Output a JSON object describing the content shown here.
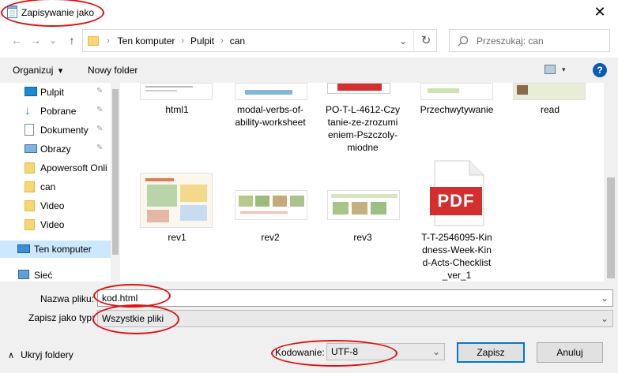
{
  "window": {
    "title": "Zapisywanie jako",
    "close_glyph": "✕"
  },
  "nav": {
    "back_glyph": "←",
    "forward_glyph": "→",
    "recent_glyph": "⌄",
    "up_glyph": "↑",
    "breadcrumb": [
      "Ten komputer",
      "Pulpit",
      "can"
    ],
    "separator": "›",
    "dropdown_glyph": "⌄",
    "refresh_glyph": "↻",
    "search_placeholder": "Przeszukaj: can"
  },
  "toolbar": {
    "organize_label": "Organizuj",
    "organize_arrow": "▾",
    "new_folder_label": "Nowy folder",
    "help_glyph": "?"
  },
  "sidebar": {
    "items": [
      {
        "label": "Pulpit",
        "icon": "desktop-icon",
        "pinned": true
      },
      {
        "label": "Pobrane",
        "icon": "download-icon",
        "pinned": true
      },
      {
        "label": "Dokumenty",
        "icon": "documents-icon",
        "pinned": true
      },
      {
        "label": "Obrazy",
        "icon": "pictures-icon",
        "pinned": true
      },
      {
        "label": "Apowersoft Onli",
        "icon": "folder-icon",
        "pinned": false
      },
      {
        "label": "can",
        "icon": "folder-icon",
        "pinned": false
      },
      {
        "label": "Video",
        "icon": "folder-icon",
        "pinned": false
      },
      {
        "label": "Video",
        "icon": "folder-icon",
        "pinned": false
      },
      {
        "label": "Ten komputer",
        "icon": "computer-icon",
        "pinned": false
      },
      {
        "label": "Sieć",
        "icon": "network-icon",
        "pinned": false
      }
    ],
    "pin_glyph": "📌"
  },
  "files": {
    "row1": [
      "html1",
      "modal-verbs-of-\nability-worksheet",
      "PO-T-L-4612-Czy\ntanie-ze-zrozumi\neniem-Pszczoly-\nmiodne",
      "Przechwytywanie",
      "read"
    ],
    "row2": [
      "rev1",
      "rev2",
      "rev3",
      "T-T-2546095-Kin\ndness-Week-Kin\nd-Acts-Checklist\n_ver_1"
    ],
    "pdf_label": "PDF"
  },
  "form": {
    "filename_label": "Nazwa pliku:",
    "filename_value": "kod.html",
    "type_label": "Zapisz jako typ:",
    "type_value": "Wszystkie pliki",
    "encoding_label": "Kodowanie:",
    "encoding_value": "UTF-8",
    "hide_folders_label": "Ukryj foldery",
    "hide_arrow": "∧",
    "save_label": "Zapisz",
    "cancel_label": "Anuluj",
    "combo_arrow": "⌄"
  },
  "colors": {
    "annotation": "#e01010",
    "accent": "#0078d7",
    "pdf_red": "#d32f2f"
  }
}
